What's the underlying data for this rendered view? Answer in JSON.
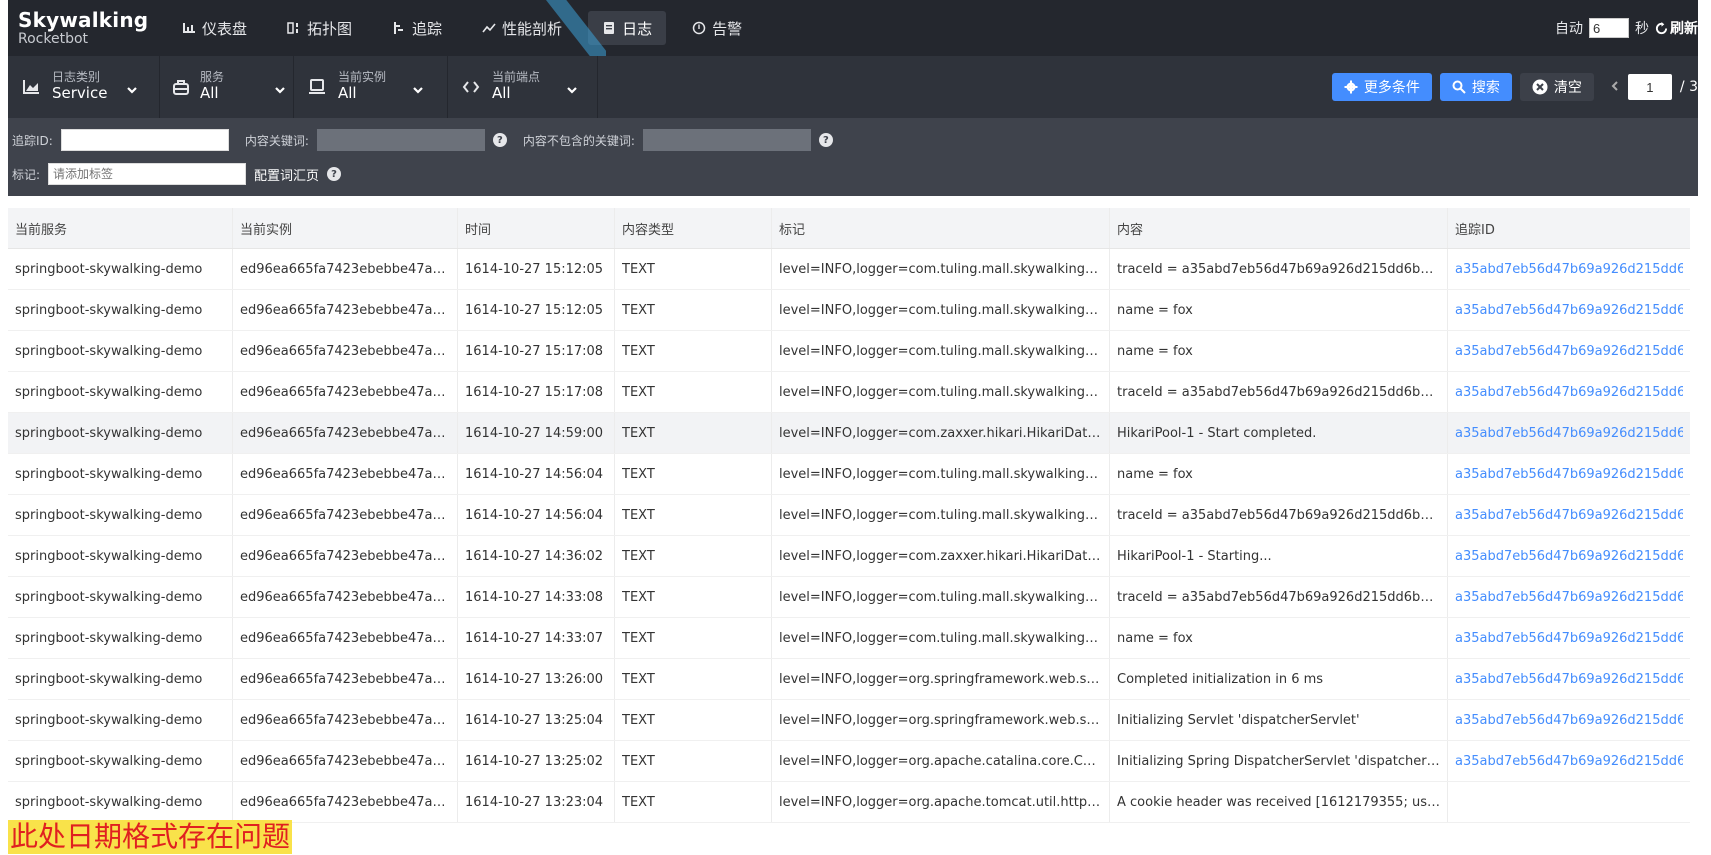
{
  "brand": {
    "name": "Skywalking",
    "sub": "Rocketbot"
  },
  "nav": [
    {
      "label": "仪表盘",
      "icon": "dashboard-icon",
      "active": false
    },
    {
      "label": "拓扑图",
      "icon": "topology-icon",
      "active": false
    },
    {
      "label": "追踪",
      "icon": "trace-icon",
      "active": false
    },
    {
      "label": "性能剖析",
      "icon": "profile-icon",
      "active": false
    },
    {
      "label": "日志",
      "icon": "log-icon",
      "active": true
    },
    {
      "label": "告警",
      "icon": "alarm-icon",
      "active": false
    }
  ],
  "topRight": {
    "auto_label": "自动",
    "interval": "6",
    "unit": "秒",
    "refresh_label": "刷新"
  },
  "filters": [
    {
      "label": "日志类别",
      "value": "Service",
      "icon": "chart-icon"
    },
    {
      "label": "服务",
      "value": "All",
      "icon": "service-icon"
    },
    {
      "label": "当前实例",
      "value": "All",
      "icon": "instance-icon"
    },
    {
      "label": "当前端点",
      "value": "All",
      "icon": "endpoint-icon"
    }
  ],
  "actions": {
    "more": "更多条件",
    "search": "搜索",
    "clear": "清空"
  },
  "pager": {
    "current": "1",
    "total": "/ 3"
  },
  "conditions": {
    "trace_id_label": "追踪ID:",
    "keyword_label": "内容关键词:",
    "exclude_label": "内容不包含的关键词:",
    "tag_label": "标记:",
    "tag_placeholder": "请添加标签",
    "vocab_label": "配置词汇页"
  },
  "table": {
    "headers": [
      "当前服务",
      "当前实例",
      "时间",
      "内容类型",
      "标记",
      "内容",
      "追踪ID"
    ],
    "rows": [
      [
        "springboot-skywalking-demo",
        "ed96ea665fa7423ebebbe47a7...",
        "1614-10-27 15:12:05",
        "TEXT",
        "level=INFO,logger=com.tuling.mall.skywalkingd...",
        "traceId = a35abd7eb56d47b69a926d215dd6b67...",
        "a35abd7eb56d47b69a926d215dd6l"
      ],
      [
        "springboot-skywalking-demo",
        "ed96ea665fa7423ebebbe47a7...",
        "1614-10-27 15:12:05",
        "TEXT",
        "level=INFO,logger=com.tuling.mall.skywalkingd...",
        "name = fox",
        "a35abd7eb56d47b69a926d215dd6l"
      ],
      [
        "springboot-skywalking-demo",
        "ed96ea665fa7423ebebbe47a7...",
        "1614-10-27 15:17:08",
        "TEXT",
        "level=INFO,logger=com.tuling.mall.skywalkingd...",
        "name = fox",
        "a35abd7eb56d47b69a926d215dd6l"
      ],
      [
        "springboot-skywalking-demo",
        "ed96ea665fa7423ebebbe47a7...",
        "1614-10-27 15:17:08",
        "TEXT",
        "level=INFO,logger=com.tuling.mall.skywalkingd...",
        "traceId = a35abd7eb56d47b69a926d215dd6b67...",
        "a35abd7eb56d47b69a926d215dd6l"
      ],
      [
        "springboot-skywalking-demo",
        "ed96ea665fa7423ebebbe47a7...",
        "1614-10-27 14:59:00",
        "TEXT",
        "level=INFO,logger=com.zaxxer.hikari.HikariData...",
        "HikariPool-1 - Start completed.",
        "a35abd7eb56d47b69a926d215dd6l"
      ],
      [
        "springboot-skywalking-demo",
        "ed96ea665fa7423ebebbe47a7...",
        "1614-10-27 14:56:04",
        "TEXT",
        "level=INFO,logger=com.tuling.mall.skywalkingd...",
        "name = fox",
        "a35abd7eb56d47b69a926d215dd6l"
      ],
      [
        "springboot-skywalking-demo",
        "ed96ea665fa7423ebebbe47a7...",
        "1614-10-27 14:56:04",
        "TEXT",
        "level=INFO,logger=com.tuling.mall.skywalkingd...",
        "traceId = a35abd7eb56d47b69a926d215dd6b67...",
        "a35abd7eb56d47b69a926d215dd6l"
      ],
      [
        "springboot-skywalking-demo",
        "ed96ea665fa7423ebebbe47a7...",
        "1614-10-27 14:36:02",
        "TEXT",
        "level=INFO,logger=com.zaxxer.hikari.HikariData...",
        "HikariPool-1 - Starting...",
        "a35abd7eb56d47b69a926d215dd6l"
      ],
      [
        "springboot-skywalking-demo",
        "ed96ea665fa7423ebebbe47a7...",
        "1614-10-27 14:33:08",
        "TEXT",
        "level=INFO,logger=com.tuling.mall.skywalkingd...",
        "traceId = a35abd7eb56d47b69a926d215dd6b67...",
        "a35abd7eb56d47b69a926d215dd6l"
      ],
      [
        "springboot-skywalking-demo",
        "ed96ea665fa7423ebebbe47a7...",
        "1614-10-27 14:33:07",
        "TEXT",
        "level=INFO,logger=com.tuling.mall.skywalkingd...",
        "name = fox",
        "a35abd7eb56d47b69a926d215dd6l"
      ],
      [
        "springboot-skywalking-demo",
        "ed96ea665fa7423ebebbe47a7...",
        "1614-10-27 13:26:00",
        "TEXT",
        "level=INFO,logger=org.springframework.web.se...",
        "Completed initialization in 6 ms",
        "a35abd7eb56d47b69a926d215dd6l"
      ],
      [
        "springboot-skywalking-demo",
        "ed96ea665fa7423ebebbe47a7...",
        "1614-10-27 13:25:04",
        "TEXT",
        "level=INFO,logger=org.springframework.web.se...",
        "Initializing Servlet 'dispatcherServlet'",
        "a35abd7eb56d47b69a926d215dd6l"
      ],
      [
        "springboot-skywalking-demo",
        "ed96ea665fa7423ebebbe47a7...",
        "1614-10-27 13:25:02",
        "TEXT",
        "level=INFO,logger=org.apache.catalina.core.Co...",
        "Initializing Spring DispatcherServlet 'dispatcherS...",
        "a35abd7eb56d47b69a926d215dd6l"
      ],
      [
        "springboot-skywalking-demo",
        "ed96ea665fa7423ebebbe47a7...",
        "1614-10-27 13:23:04",
        "TEXT",
        "level=INFO,logger=org.apache.tomcat.util.http....",
        "A cookie header was received [1612179355; use...",
        ""
      ]
    ],
    "highlight_row": 4
  },
  "note": "此处日期格式存在问题"
}
